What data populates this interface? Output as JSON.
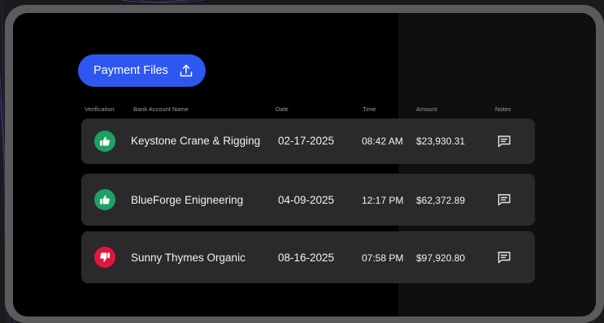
{
  "toolbar": {
    "payment_files_label": "Payment Files"
  },
  "columns": {
    "verification": "Verification",
    "bank_account_name": "Bank Account Name",
    "date": "Date",
    "time": "Time",
    "amount": "Amount",
    "notes": "Notes"
  },
  "rows": [
    {
      "verification": "approved",
      "name": "Keystone Crane & Rigging",
      "date": "02-17-2025",
      "time": "08:42 AM",
      "amount": "$23,930.31"
    },
    {
      "verification": "approved",
      "name": "BlueForge  Enigneering",
      "date": "04-09-2025",
      "time": "12:17 PM",
      "amount": "$62,372.89"
    },
    {
      "verification": "rejected",
      "name": "Sunny Thymes Organic",
      "date": "08-16-2025",
      "time": "07:58 PM",
      "amount": "$97,920.80"
    }
  ],
  "colors": {
    "button_blue": "#2e57f0",
    "approved_green": "#1fa065",
    "rejected_red": "#e2163c",
    "row_bg": "#2a2a2d"
  },
  "icons": {
    "upload": "upload-icon",
    "approved": "thumbs-up-icon",
    "rejected": "thumbs-down-icon",
    "notes": "message-icon"
  }
}
